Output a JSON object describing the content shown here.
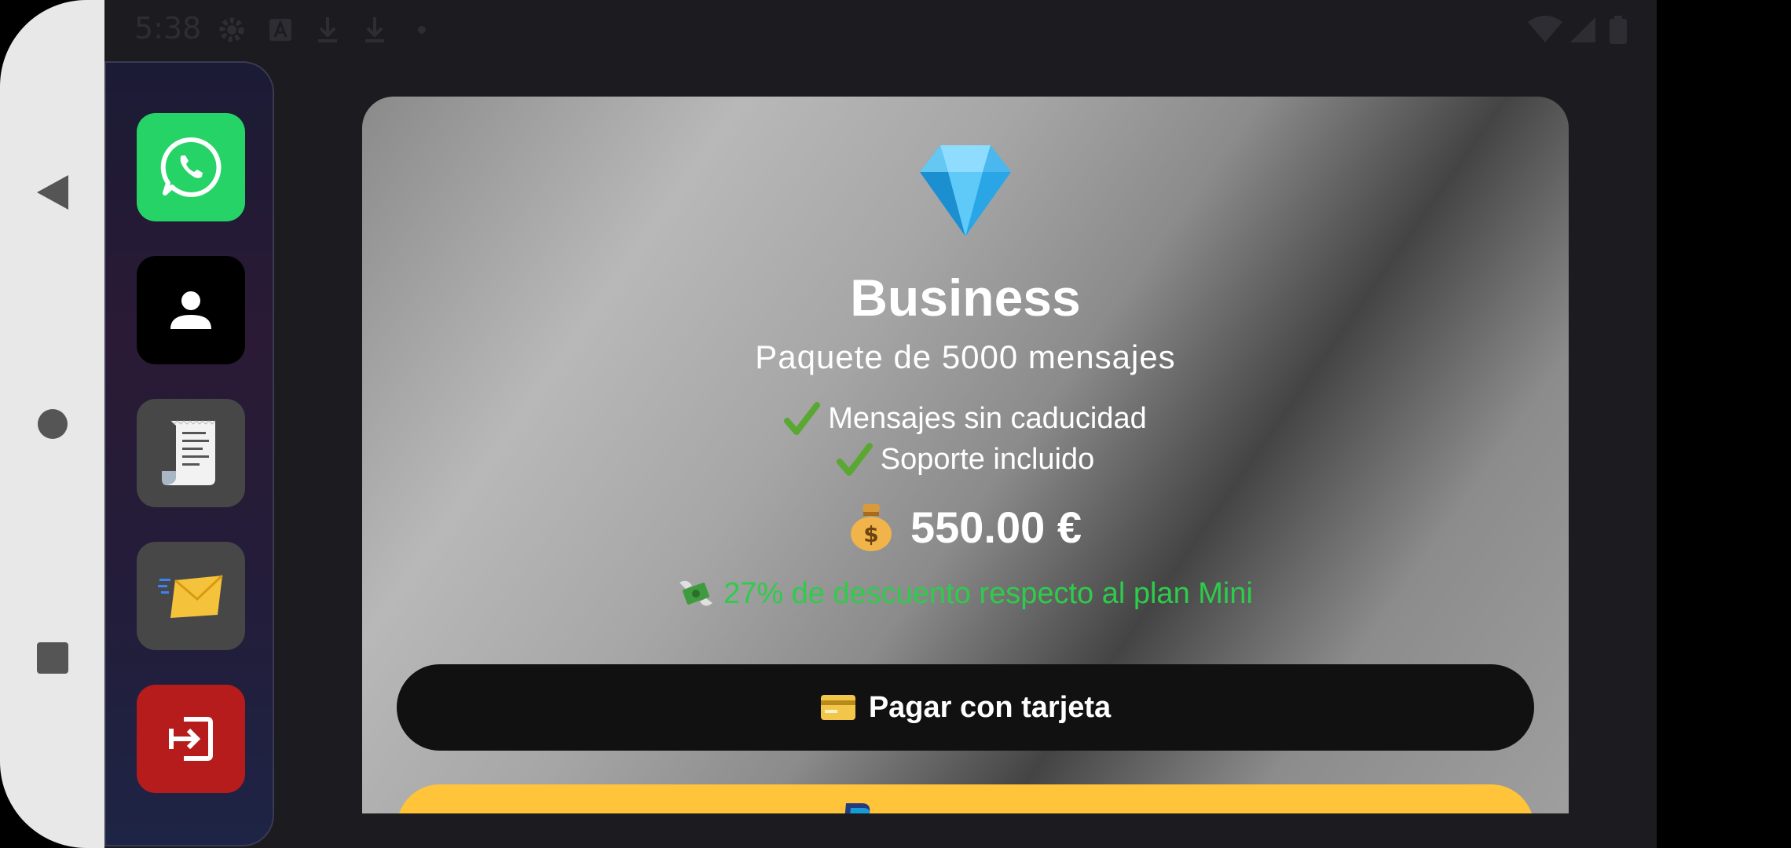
{
  "status_bar": {
    "time": "5:38"
  },
  "side_panel": {
    "apps": [
      {
        "name": "whatsapp",
        "icon": "whatsapp-icon"
      },
      {
        "name": "contacts",
        "icon": "person-icon"
      },
      {
        "name": "receipt",
        "icon": "receipt-icon"
      },
      {
        "name": "mail",
        "icon": "incoming-envelope-icon"
      },
      {
        "name": "logout",
        "icon": "exit-icon"
      }
    ]
  },
  "plan": {
    "icon": "gem-icon",
    "name": "Business",
    "subtitle": "Paquete de 5000 mensajes",
    "features": [
      "Mensajes sin caducidad",
      "Soporte incluido"
    ],
    "price": "550.00 €",
    "discount": "27% de descuento respecto al plan Mini",
    "pay_card_label": "Pagar con tarjeta"
  },
  "colors": {
    "whatsapp_green": "#25d366",
    "logout_red": "#b71c1c",
    "discount_green": "#2ecc4a",
    "paypal_yellow": "#ffc439"
  }
}
